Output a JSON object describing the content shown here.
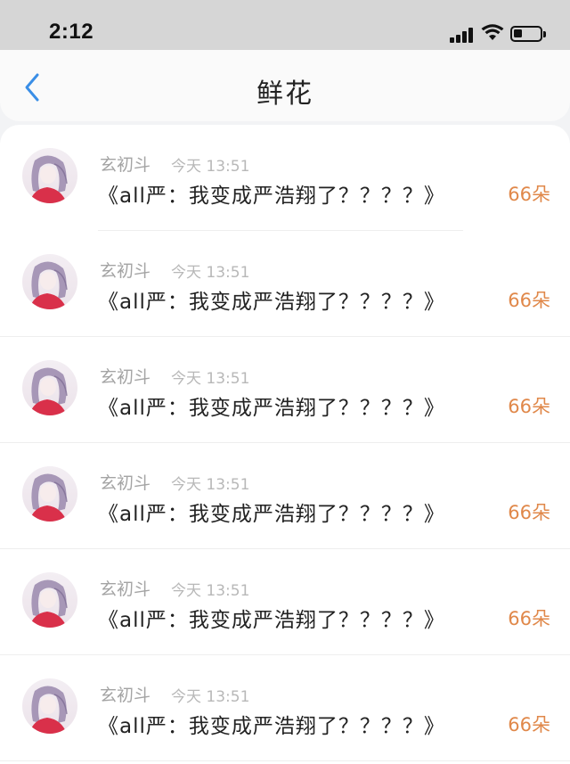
{
  "status_bar": {
    "time": "2:12"
  },
  "nav": {
    "title": "鲜花"
  },
  "rows": [
    {
      "name": "玄初斗",
      "time": "今天 13:51",
      "title": "《all严：我变成严浩翔了？？？？》",
      "count": "66朵"
    },
    {
      "name": "玄初斗",
      "time": "今天 13:51",
      "title": "《all严：我变成严浩翔了？？？？》",
      "count": "66朵"
    },
    {
      "name": "玄初斗",
      "time": "今天 13:51",
      "title": "《all严：我变成严浩翔了？？？？》",
      "count": "66朵"
    },
    {
      "name": "玄初斗",
      "time": "今天 13:51",
      "title": "《all严：我变成严浩翔了？？？？》",
      "count": "66朵"
    },
    {
      "name": "玄初斗",
      "time": "今天 13:51",
      "title": "《all严：我变成严浩翔了？？？？》",
      "count": "66朵"
    },
    {
      "name": "玄初斗",
      "time": "今天 13:51",
      "title": "《all严：我变成严浩翔了？？？？》",
      "count": "66朵"
    }
  ],
  "colors": {
    "accent": "#e0884a",
    "back_arrow": "#3a8ee6"
  }
}
